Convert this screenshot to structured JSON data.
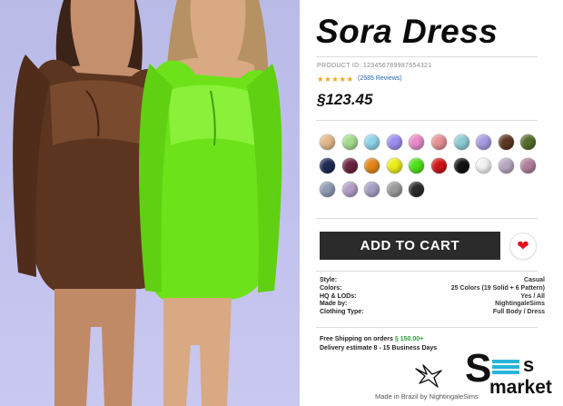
{
  "product": {
    "title": "Sora Dress",
    "product_id": "PRODUCT ID: 123456789987654321",
    "stars": "★★★★★",
    "reviews": "(2585 Reviews)",
    "price": "§123.45"
  },
  "swatches": [
    "#e2b88b",
    "#a6dc8e",
    "#8fd3e8",
    "#9c8ff0",
    "#e88ac8",
    "#e59192",
    "#8fcbd4",
    "#a79ae0",
    "#5c3722",
    "#556b2a",
    "#1e2a55",
    "#6a2440",
    "#e3871c",
    "#ecec18",
    "#4ee11a",
    "#cf1518",
    "#121212",
    "#f2f2f2",
    "#b8a6c0",
    "#b07f9a",
    "#8d9bb3",
    "#b39ec7",
    "#a6a0c2",
    "#9a9a9a",
    "#2a2a2a"
  ],
  "buttons": {
    "add_to_cart": "ADD TO CART",
    "favorite_icon": "heart-icon"
  },
  "specs": [
    {
      "label": "Style:",
      "value": "Casual"
    },
    {
      "label": "Colors:",
      "value": "25 Colors (19 Solid + 6 Pattern)"
    },
    {
      "label": "HQ & LODs:",
      "value": "Yes / All"
    },
    {
      "label": "Made by:",
      "value": "NightingaleSims"
    },
    {
      "label": "Clothing Type:",
      "value": "Full Body / Dress"
    }
  ],
  "shipping": {
    "free_label": "Free Shipping on orders",
    "free_amount": "§ 150.00+",
    "delivery_label": "Delivery estimate",
    "delivery_value": "8 - 15 Business Days"
  },
  "footer": {
    "made_in": "Made in Brazil by NightingaleSims",
    "logo_big": "S",
    "logo_small": "s",
    "logo_market": "market"
  },
  "colors": {
    "accent_green": "#2e9c3a",
    "cart_bg": "#2b2b2b",
    "heart": "#e0131e",
    "link_blue": "#2465b6"
  }
}
